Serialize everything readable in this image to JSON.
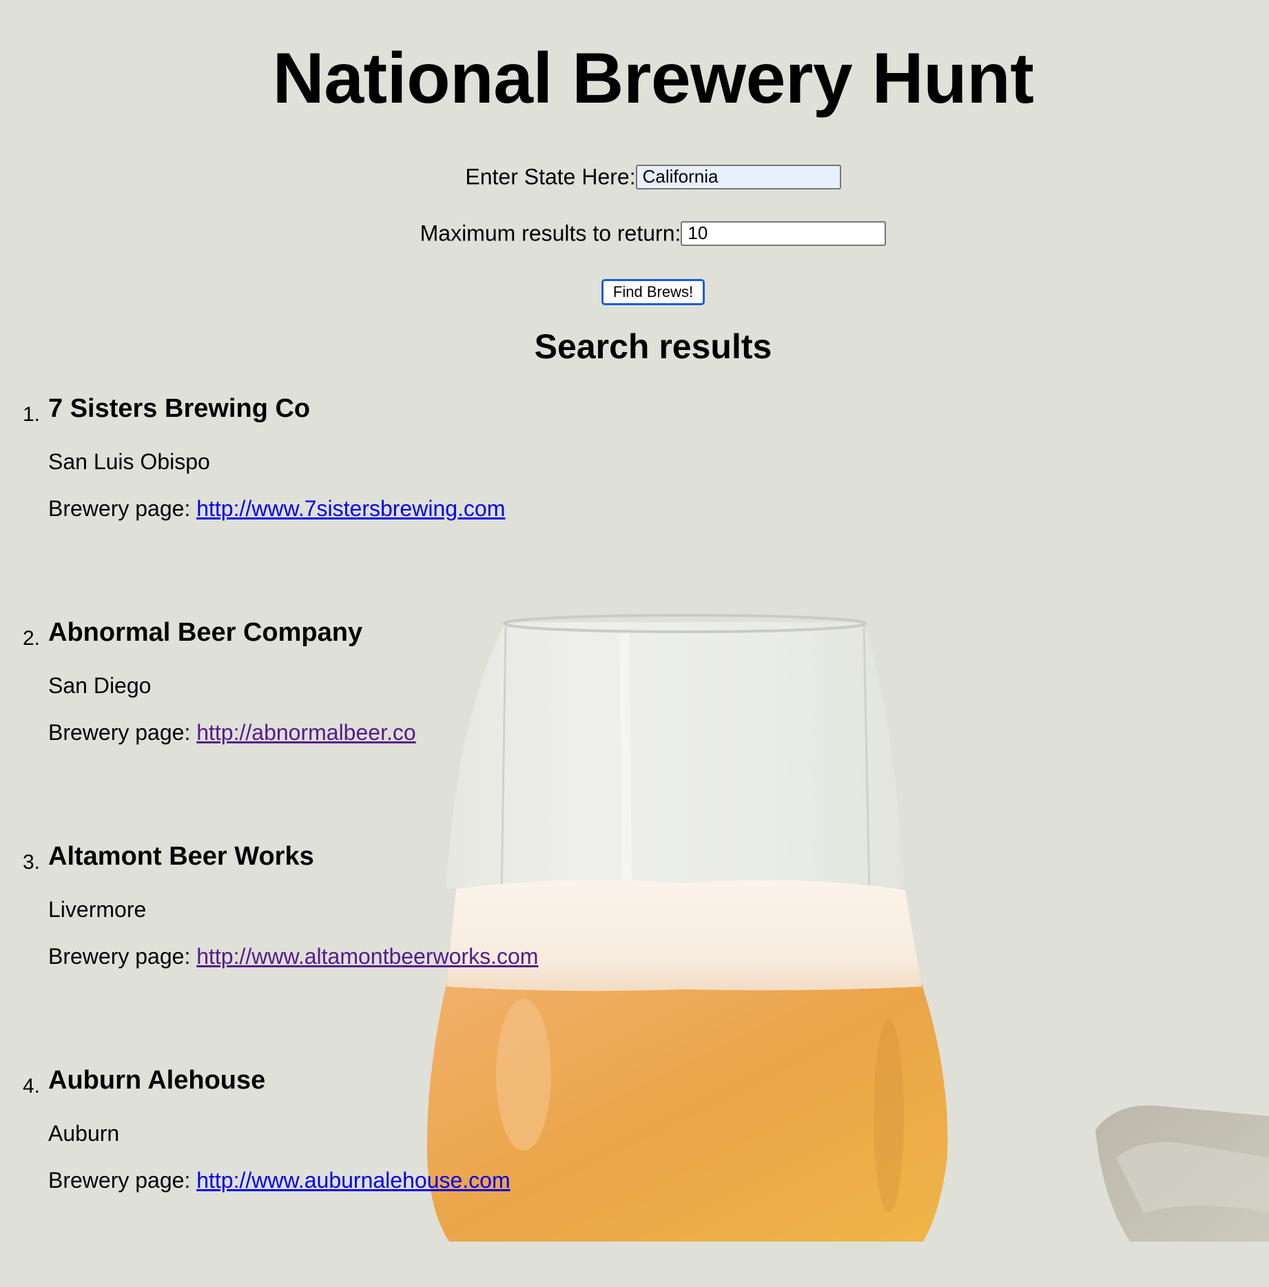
{
  "page": {
    "title": "National Brewery Hunt"
  },
  "form": {
    "state_label": "Enter State Here:",
    "state_value": "California",
    "max_label": "Maximum results to return:",
    "max_value": "10",
    "submit_label": "Find Brews!"
  },
  "results": {
    "heading": "Search results",
    "page_label": "Brewery page:",
    "items": [
      {
        "number": "1.",
        "name": "7 Sisters Brewing Co",
        "city": "San Luis Obispo",
        "url": "http://www.7sistersbrewing.com",
        "visited": false
      },
      {
        "number": "2.",
        "name": "Abnormal Beer Company",
        "city": "San Diego",
        "url": "http://abnormalbeer.co",
        "visited": true
      },
      {
        "number": "3.",
        "name": "Altamont Beer Works",
        "city": "Livermore",
        "url": "http://www.altamontbeerworks.com",
        "visited": true
      },
      {
        "number": "4.",
        "name": "Auburn Alehouse",
        "city": "Auburn",
        "url": "http://www.auburnalehouse.com",
        "visited": false
      }
    ]
  },
  "colors": {
    "background": "#dfe0d8",
    "link": "#0000ee",
    "visited_link": "#551a8b",
    "button_border": "#1f5ad6",
    "autofill_background": "#e8f0fe"
  },
  "background_image": {
    "icon": "beer-glass-photo"
  }
}
